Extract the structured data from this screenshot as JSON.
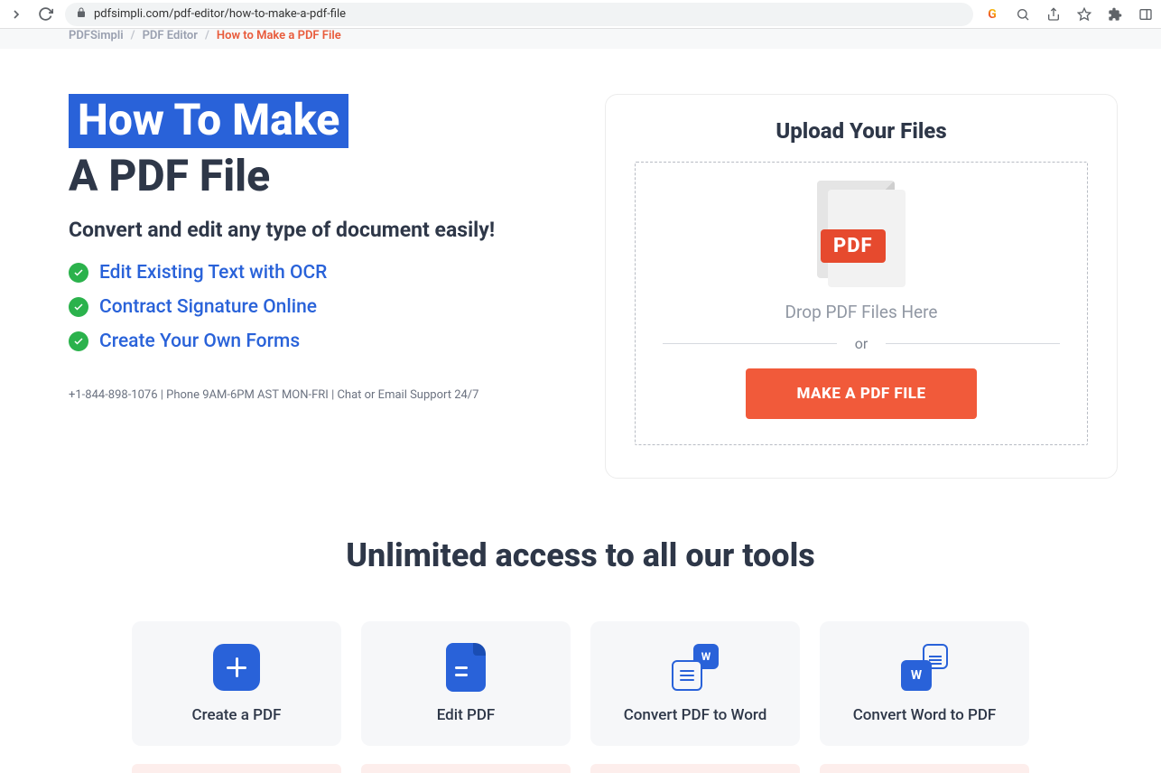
{
  "browser": {
    "url": "pdfsimpli.com/pdf-editor/how-to-make-a-pdf-file"
  },
  "breadcrumb": {
    "root": "PDFSimpli",
    "mid": "PDF Editor",
    "current": "How to Make a PDF File"
  },
  "hero": {
    "title_highlight": "How To Make",
    "title_rest": "A PDF File",
    "subtitle": "Convert and edit any type of document easily!",
    "features": [
      "Edit Existing Text with OCR",
      "Contract Signature Online",
      "Create Your Own Forms"
    ],
    "support": "+1-844-898-1076  |  Phone 9AM-6PM AST MON-FRI  |  Chat or Email Support 24/7"
  },
  "upload": {
    "title": "Upload Your Files",
    "badge": "PDF",
    "drop_text": "Drop PDF Files Here",
    "or": "or",
    "button": "MAKE A PDF FILE"
  },
  "tools": {
    "heading": "Unlimited access to all our tools",
    "items": [
      {
        "label": "Create a PDF"
      },
      {
        "label": "Edit PDF"
      },
      {
        "label": "Convert PDF to Word"
      },
      {
        "label": "Convert Word to PDF"
      }
    ],
    "word_badge": "W"
  }
}
